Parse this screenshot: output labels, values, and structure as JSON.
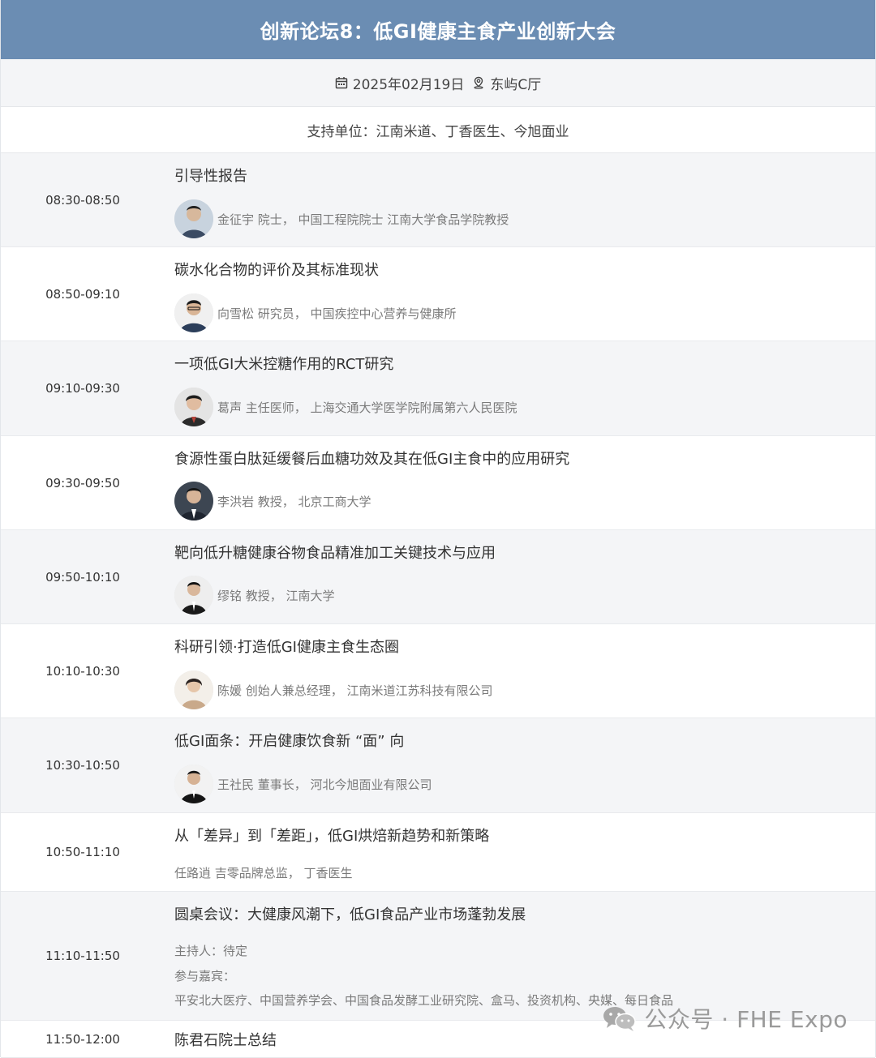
{
  "header": {
    "title": "创新论坛8：低GI健康主食产业创新大会"
  },
  "meta": {
    "date": "2025年02月19日",
    "location": "东屿C厅",
    "date_icon": "calendar-icon",
    "location_icon": "location-pin-icon"
  },
  "support": {
    "text": "支持单位：江南米道、丁香医生、今旭面业"
  },
  "agenda": [
    {
      "time": "08:30-08:50",
      "title": "引导性报告",
      "speaker": "金征宇 院士，  中国工程院院士 江南大学食品学院教授"
    },
    {
      "time": "08:50-09:10",
      "title": "碳水化合物的评价及其标准现状",
      "speaker": "向雪松 研究员，  中国疾控中心营养与健康所"
    },
    {
      "time": "09:10-09:30",
      "title": "一项低GI大米控糖作用的RCT研究",
      "speaker": "葛声 主任医师，  上海交通大学医学院附属第六人民医院"
    },
    {
      "time": "09:30-09:50",
      "title": "食源性蛋白肽延缓餐后血糖功效及其在低GI主食中的应用研究",
      "speaker": "李洪岩 教授，  北京工商大学"
    },
    {
      "time": "09:50-10:10",
      "title": "靶向低升糖健康谷物食品精准加工关键技术与应用",
      "speaker": "缪铭 教授，  江南大学"
    },
    {
      "time": "10:10-10:30",
      "title": "科研引领·打造低GI健康主食生态圈",
      "speaker": "陈媛 创始人兼总经理，  江南米道江苏科技有限公司"
    },
    {
      "time": "10:30-10:50",
      "title": "低GI面条：开启健康饮食新 “面” 向",
      "speaker": "王社民 董事长，  河北今旭面业有限公司"
    },
    {
      "time": "10:50-11:10",
      "title": "从「差异」到「差距」，低GI烘焙新趋势和新策略",
      "speaker": "任路逍 吉零品牌总监，  丁香医生"
    },
    {
      "time": "11:10-11:50",
      "title": "圆桌会议：大健康风潮下，低GI食品产业市场蓬勃发展",
      "host": "主持人：待定",
      "guests_label": "参与嘉宾：",
      "guests": "平安北大医疗、中国营养学会、中国食品发酵工业研究院、盒马、投资机构、央媒、每日食品"
    },
    {
      "time": "11:50-12:00",
      "title": "陈君石院士总结"
    }
  ],
  "watermark": {
    "text": "公众号 · FHE Expo"
  },
  "colors": {
    "header_bg": "#6b8db3",
    "row_shade": "#f4f5f7"
  }
}
